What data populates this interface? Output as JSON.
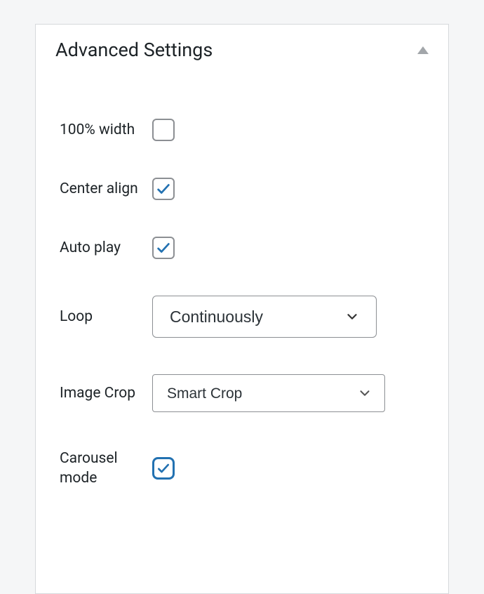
{
  "panel": {
    "title": "Advanced Settings"
  },
  "settings": {
    "full_width": {
      "label": "100% width",
      "checked": false
    },
    "center_align": {
      "label": "Center align",
      "checked": true
    },
    "auto_play": {
      "label": "Auto play",
      "checked": true
    },
    "loop": {
      "label": "Loop",
      "selected": "Continuously"
    },
    "image_crop": {
      "label": "Image Crop",
      "selected": "Smart Crop"
    },
    "carousel_mode": {
      "label": "Carousel mode",
      "checked": true
    }
  }
}
